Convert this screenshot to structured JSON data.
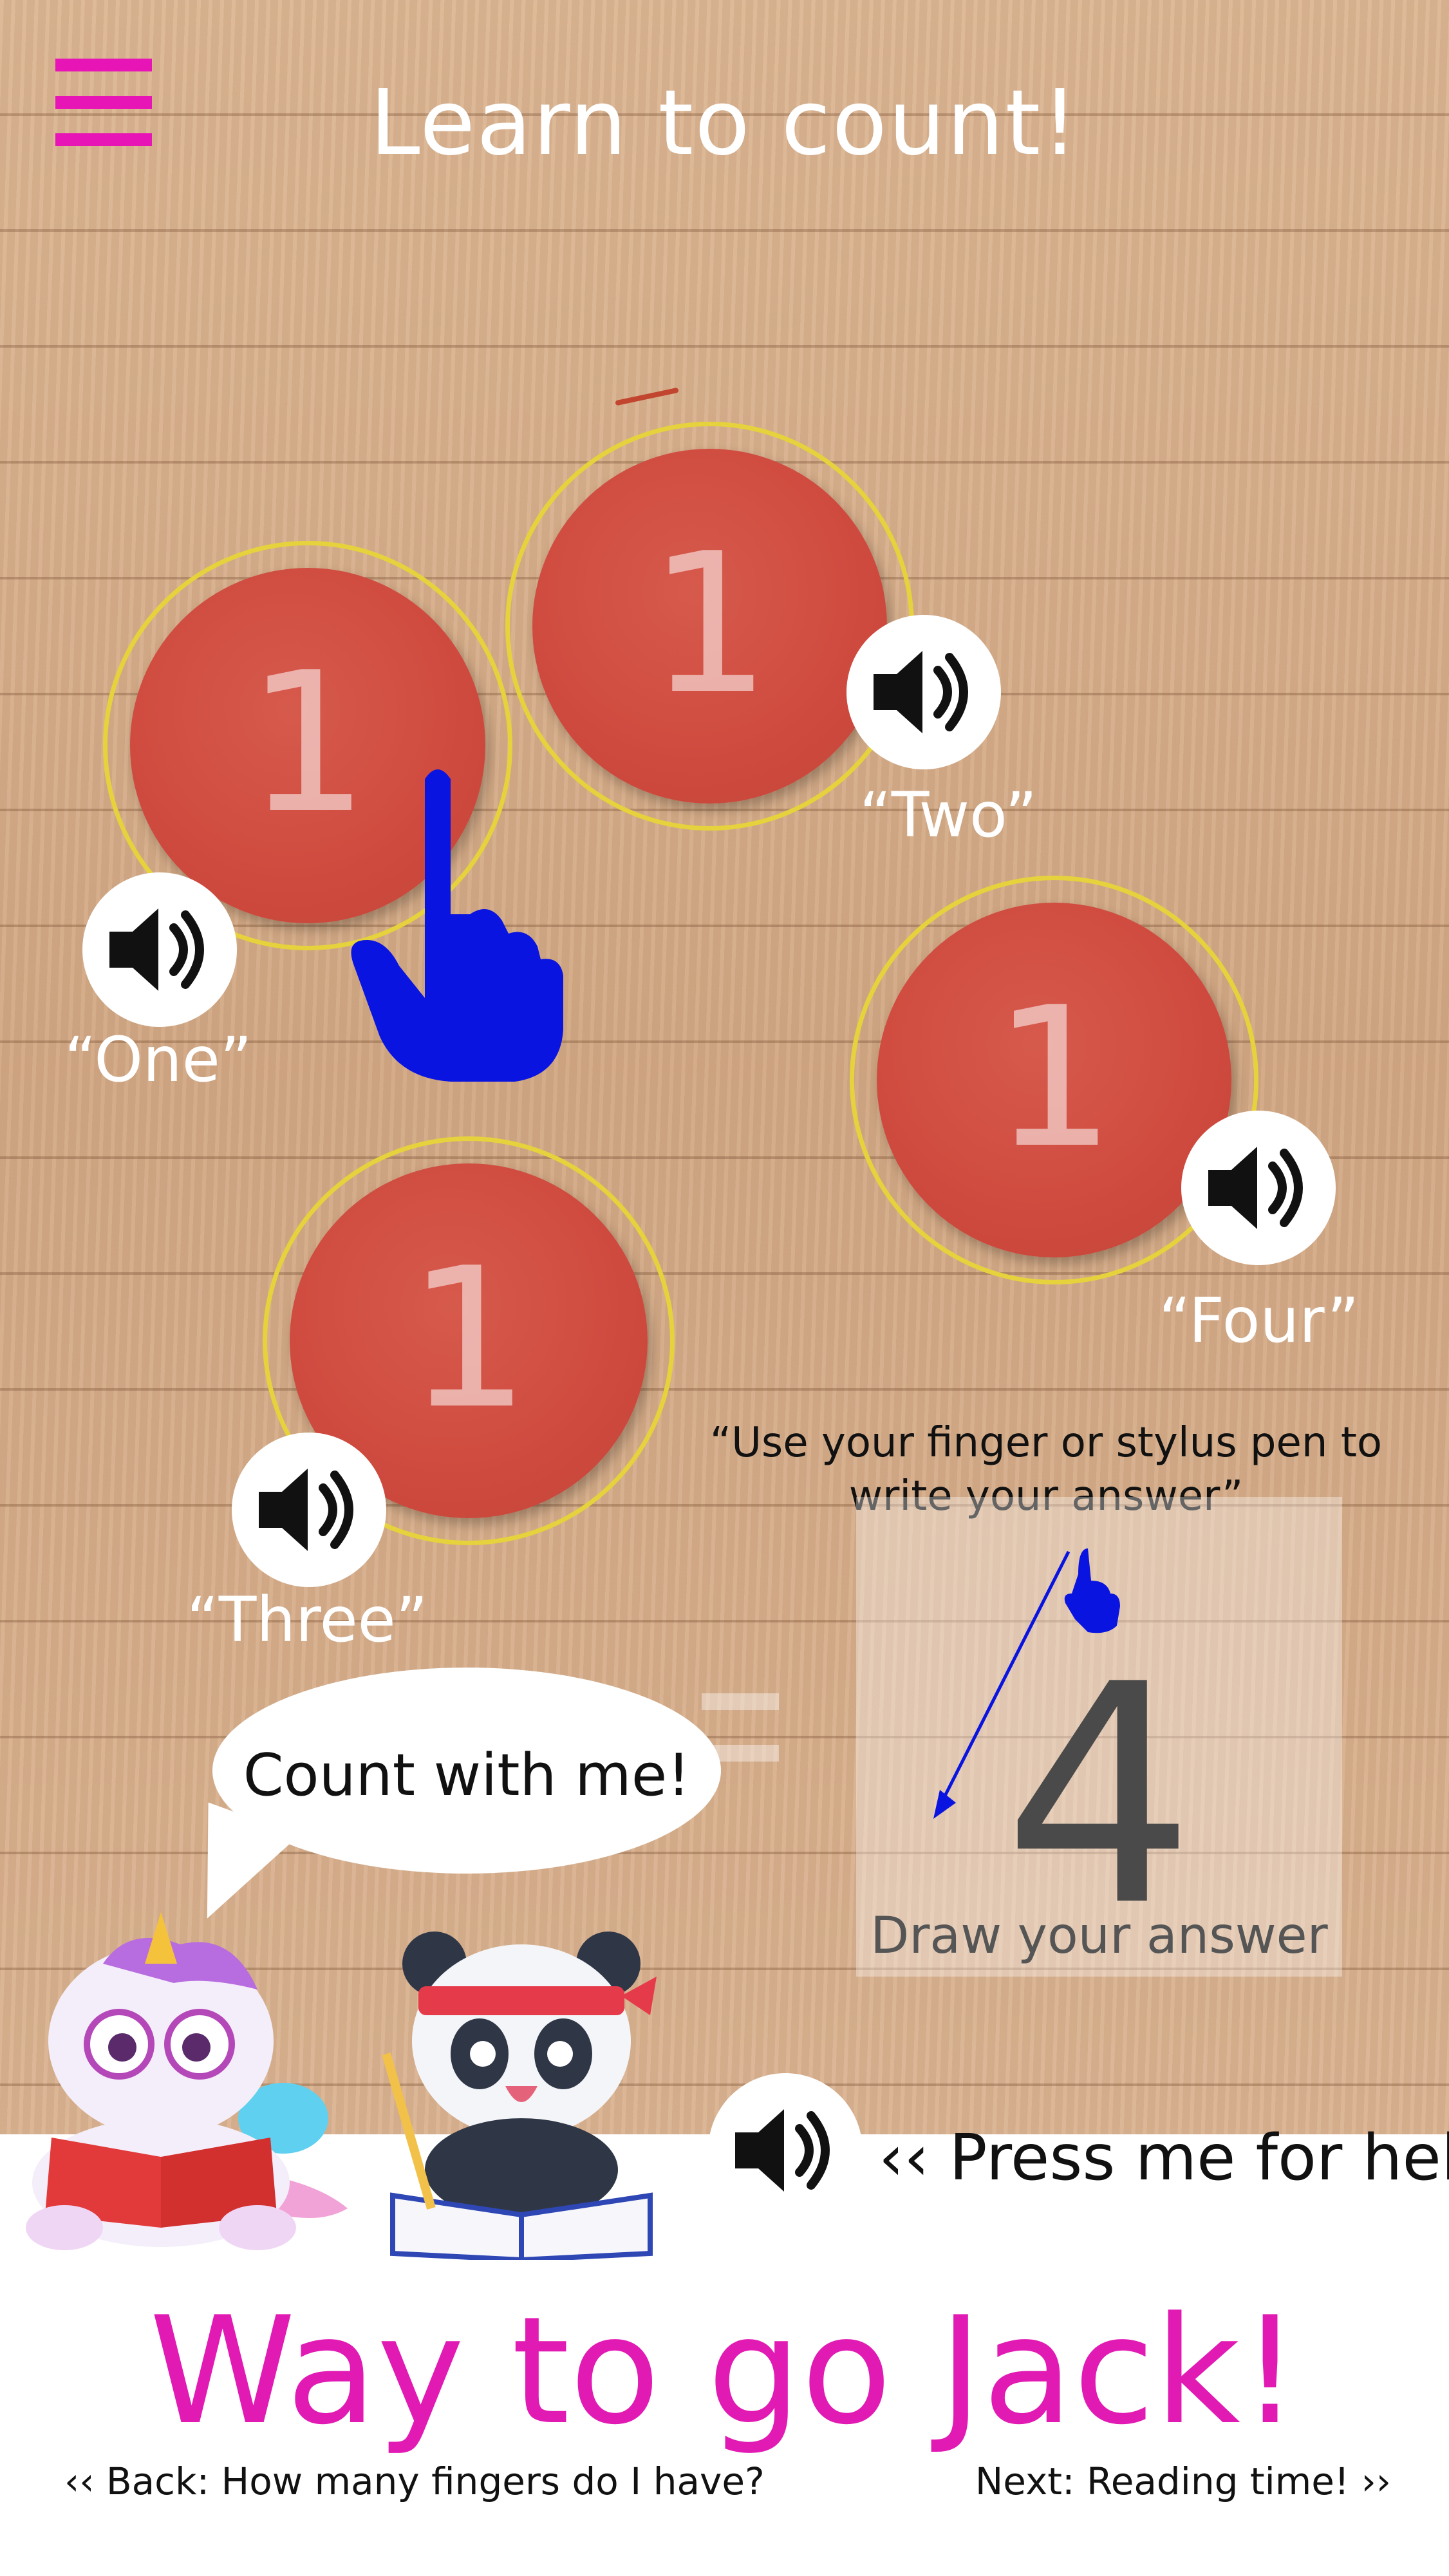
{
  "header": {
    "title": "Learn to count!"
  },
  "tokens": [
    {
      "number": "1",
      "spoken": "“One”"
    },
    {
      "number": "1",
      "spoken": "“Two”"
    },
    {
      "number": "1",
      "spoken": "“Three”"
    },
    {
      "number": "1",
      "spoken": "“Four”"
    }
  ],
  "speech_bubble": {
    "text": "Count with me!"
  },
  "answer": {
    "instruction": "“Use your finger or stylus pen to write your answer”",
    "digit": "4",
    "prompt": "Draw your answer"
  },
  "help": {
    "label": "‹‹ Press me for help"
  },
  "praise": "Way to go Jack!",
  "navigation": {
    "back": "‹‹ Back: How many fingers do I have?",
    "next": "Next: Reading time! ››"
  },
  "colors": {
    "accent_pink": "#e815b6",
    "token_red": "#cf4a3e",
    "ring_yellow": "#e5d23c",
    "hand_blue": "#0a14e0",
    "wood": "#d8b08c"
  },
  "icons": [
    "menu-icon",
    "speaker-icon",
    "pointing-hand-icon",
    "unicorn-mascot",
    "panda-mascot"
  ]
}
